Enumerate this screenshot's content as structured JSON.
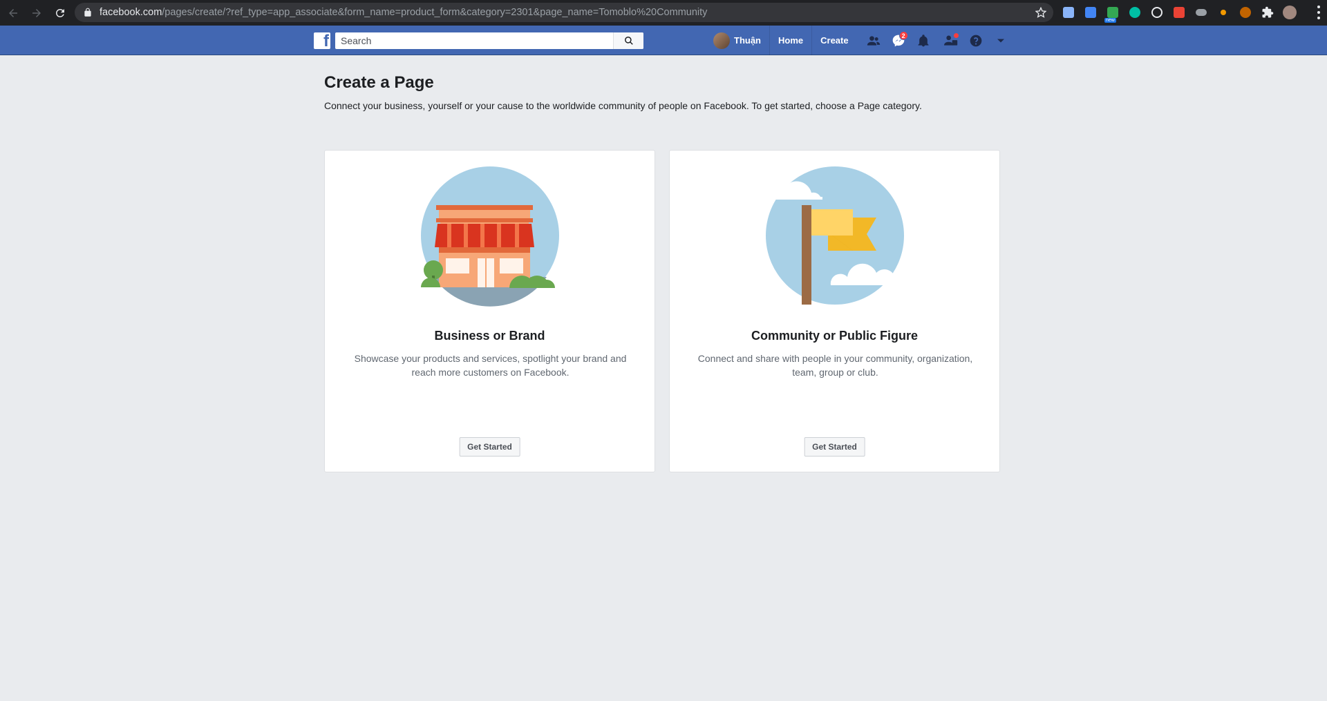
{
  "browser": {
    "url_host": "facebook.com",
    "url_path": "/pages/create/?ref_type=app_associate&form_name=product_form&category=2301&page_name=Tomoblo%20Community",
    "extension_new_badge": "new"
  },
  "header": {
    "search_placeholder": "Search",
    "profile_name": "Thuận",
    "home_label": "Home",
    "create_label": "Create",
    "messages_badge": "2"
  },
  "main": {
    "title": "Create a Page",
    "subtitle": "Connect your business, yourself or your cause to the worldwide community of people on Facebook. To get started, choose a Page category.",
    "cards": [
      {
        "title": "Business or Brand",
        "description": "Showcase your products and services, spotlight your brand and reach more customers on Facebook.",
        "button": "Get Started",
        "illustration": "storefront-icon"
      },
      {
        "title": "Community or Public Figure",
        "description": "Connect and share with people in your community, organization, team, group or club.",
        "button": "Get Started",
        "illustration": "flag-icon"
      }
    ]
  },
  "colors": {
    "fb_blue": "#4267b2",
    "page_bg": "#e9ebee",
    "badge_red": "#fa3e3e"
  }
}
